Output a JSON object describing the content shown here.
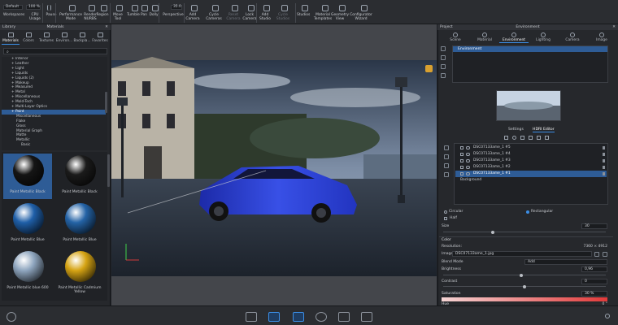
{
  "toolbar": {
    "workspace_value": "Default",
    "zoom_value": "100 %",
    "focal_value": "35.0",
    "buttons": [
      {
        "label": "Workspaces",
        "disabled": false
      },
      {
        "label": "CPU Usage",
        "disabled": false
      },
      {
        "label": "Pause",
        "disabled": false
      },
      {
        "label": "Performance Mode",
        "disabled": false
      },
      {
        "label": "Render NURBS",
        "disabled": false
      },
      {
        "label": "Region",
        "disabled": false
      },
      {
        "label": "Move Tool",
        "disabled": false
      },
      {
        "label": "Tumble",
        "disabled": false
      },
      {
        "label": "Pan",
        "disabled": false
      },
      {
        "label": "Dolly",
        "disabled": false
      },
      {
        "label": "Perspective",
        "disabled": false
      },
      {
        "label": "Add Camera",
        "disabled": false
      },
      {
        "label": "Cycle Cameras",
        "disabled": false
      },
      {
        "label": "Reset Camera",
        "disabled": true
      },
      {
        "label": "Lock Camera",
        "disabled": false
      },
      {
        "label": "Add Studio",
        "disabled": false
      },
      {
        "label": "Cycle Studios",
        "disabled": true
      },
      {
        "label": "Studios",
        "disabled": false
      },
      {
        "label": "Material Templates",
        "disabled": false
      },
      {
        "label": "Geometry View",
        "disabled": false
      },
      {
        "label": "Configurator Wizard",
        "disabled": false
      }
    ]
  },
  "left_panel": {
    "library_title": "Library",
    "panel_title": "Materials",
    "tabs": [
      "Materials",
      "Colors",
      "Textures",
      "Environ...",
      "Backpla...",
      "Favorites"
    ],
    "active_tab": 0,
    "tree": [
      {
        "label": "Interior",
        "indent": 1,
        "selected": false
      },
      {
        "label": "Leather",
        "indent": 1,
        "selected": false
      },
      {
        "label": "Light",
        "indent": 1,
        "selected": false
      },
      {
        "label": "Liquids",
        "indent": 1,
        "selected": false
      },
      {
        "label": "Liquids (2)",
        "indent": 1,
        "selected": false
      },
      {
        "label": "Makeup",
        "indent": 1,
        "selected": false
      },
      {
        "label": "Measured",
        "indent": 1,
        "selected": false
      },
      {
        "label": "Metal",
        "indent": 1,
        "selected": false
      },
      {
        "label": "Miscellaneous",
        "indent": 1,
        "selected": false
      },
      {
        "label": "Mold-Tech",
        "indent": 1,
        "selected": false
      },
      {
        "label": "Multi-Layer Optics",
        "indent": 1,
        "selected": false
      },
      {
        "label": "Paint",
        "indent": 1,
        "selected": true
      },
      {
        "label": "Miscellaneous",
        "indent": 2,
        "selected": false
      },
      {
        "label": "Flake",
        "indent": 2,
        "selected": false
      },
      {
        "label": "Gloss",
        "indent": 2,
        "selected": false
      },
      {
        "label": "Material Graph",
        "indent": 2,
        "selected": false
      },
      {
        "label": "Matte",
        "indent": 2,
        "selected": false
      },
      {
        "label": "Metallic",
        "indent": 2,
        "selected": false
      },
      {
        "label": "Basic",
        "indent": 3,
        "selected": false
      }
    ],
    "thumbnails": [
      {
        "label": "Paint Metallic Black",
        "color": "#151515",
        "selected": true
      },
      {
        "label": "Paint Metallic Black",
        "color": "#1b1b1b",
        "selected": false
      },
      {
        "label": "Paint Metallic Blue",
        "color": "#1f5fa8",
        "selected": false
      },
      {
        "label": "Paint Metallic Blue",
        "color": "#2463a6",
        "selected": false
      },
      {
        "label": "Paint Metallic blue 600",
        "color": "#8fa6bf",
        "selected": false
      },
      {
        "label": "Paint Metallic Cadmium Yellow",
        "color": "#d6a414",
        "selected": false
      }
    ]
  },
  "right_panel": {
    "project_title": "Project",
    "panel_title": "Environment",
    "tabs": [
      "Scene",
      "Material",
      "Environment",
      "Lighting",
      "Camera",
      "Image"
    ],
    "active_tab": 2,
    "environment_item": "Environment",
    "sub_tabs": [
      "Settings",
      "HDRI Editor"
    ],
    "active_sub_tab": 1,
    "hdri_layers": [
      {
        "name": "DSC07133ame_1 #5",
        "selected": false
      },
      {
        "name": "DSC07133ame_1 #4",
        "selected": false
      },
      {
        "name": "DSC07133ame_1 #3",
        "selected": false
      },
      {
        "name": "DSC07133ame_1 #2",
        "selected": false
      },
      {
        "name": "DSC07133ame_1 #1",
        "selected": true
      }
    ],
    "background_label": "Background",
    "shape_options": [
      "Circular",
      "Rectangular"
    ],
    "shape_selected": 1,
    "half_label": "Half",
    "size_label": "Size",
    "size_value": "30",
    "size_fraction": 0.3,
    "color_section": "Color",
    "resolution_label": "Resolution:",
    "resolution_value": "7360 × 4912",
    "image_label": "Image:",
    "image_value": "DSC07133ame_1.jpg",
    "blend_mode_label": "Blend Mode",
    "blend_mode_value": "Add",
    "brightness_label": "Brightness",
    "brightness_value": "0,96",
    "brightness_fraction": 0.48,
    "contrast_label": "Contrast",
    "contrast_value": "0",
    "contrast_fraction": 0.5,
    "saturation_label": "Saturation",
    "saturation_value": "30 %",
    "hue_label": "Hue",
    "hue_value": "0 °"
  },
  "colors": {
    "accent": "#3b8ee6",
    "selection": "#2e5c96",
    "car": "#2a3fd9"
  }
}
